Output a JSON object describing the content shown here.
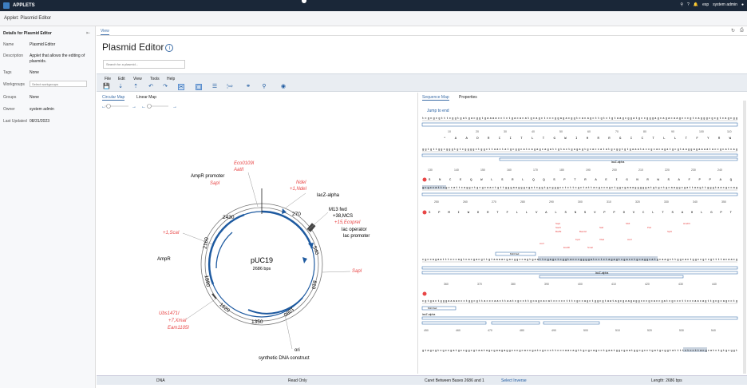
{
  "topbar": {
    "brand": "APPLETS",
    "user": "system admin",
    "notif_label": "esp"
  },
  "breadcrumb": "Applet: Plasmid Editor",
  "details": {
    "header": "Details for Plasmid Editor",
    "fields": [
      {
        "key": "Name",
        "value": "Plasmid Editor"
      },
      {
        "key": "Description",
        "value": "Applet that allows the editing of plasmids."
      },
      {
        "key": "Tags",
        "value": "None"
      },
      {
        "key": "Workgroups",
        "value": ""
      },
      {
        "key": "Groups",
        "value": "None"
      },
      {
        "key": "Owner",
        "value": "system admin"
      },
      {
        "key": "Last Updated",
        "value": "08/31/2023"
      }
    ],
    "workgroup_placeholder": "Select workgroups"
  },
  "tab_view": "View",
  "title": "Plasmid Editor",
  "search_placeholder": "Search for a plasmid...",
  "menu": [
    "File",
    "Edit",
    "View",
    "Tools",
    "Help"
  ],
  "left_tabs": [
    "Circular Map",
    "Linear Map"
  ],
  "right_tabs": [
    "Sequence Map",
    "Properties"
  ],
  "map": {
    "name": "pUC19",
    "length": "2686 bps",
    "ticks": [
      "270",
      "540",
      "810",
      "1080",
      "1350",
      "1620",
      "1890",
      "2160",
      "2430"
    ],
    "labels": {
      "ampr_promoter": "AmpR promoter",
      "ampr": "AmpR",
      "lacz": "lacZ-alpha",
      "m13": "M13 fwd",
      "mcs": "+38,MCS",
      "lacop": "lac operator",
      "lacprom": "lac promoter",
      "ori": "ori",
      "synth": "synthetic DNA construct"
    },
    "enzymes": {
      "eco0109": "Eco0109I",
      "aat2": "AatII",
      "sap_top": "SapI",
      "nde": "NdeI",
      "nde2": "+1,NdeI",
      "ecopr": "+15,EcopreI",
      "sap_right": "SapI",
      "sca": "+1,ScaI",
      "ubs": "Ubs1471I",
      "xma": "+7,XmaI",
      "eam": "Eam1105I"
    }
  },
  "seq": {
    "jump": "Jump to end",
    "row1": "tcgcgcgtttcggtgatgacggtgaaaacctctgacacatgcagctcccggagacggtcacagcttgtctgtaagcggatgccgggagcagacaagcccgtcagggcgcgtcagcgg",
    "row1_ticks": [
      "10",
      "20",
      "30",
      "40",
      "50",
      "60",
      "70",
      "80",
      "90",
      "100",
      "110"
    ],
    "row1_aa": "* A A D R C I T L T G W I H R R G I C T L L T F Y R W",
    "row2": "ggtgttggcgggtgtcggggctggcttaactatgcggcatcagagcagattgtactgagagtgcaccatatgcggtgtgaaataccgcacagatgcgtaaggagaaaataccgcatcag",
    "row2_ticks": [
      "130",
      "140",
      "150",
      "160",
      "170",
      "180",
      "190",
      "200",
      "210",
      "220",
      "230",
      "240"
    ],
    "lacz_label": "lacZ-alpha",
    "row3_aa": "S N C E Q W L S R L Q Q S P T R A E I G N R W S A F P P A Q",
    "row3": "gcgccattcgccattcaggctgcgcaactgttgggaagggcgatcggtgcgggcctcttcgctattacgccagctggcgaaagggggatgtgctgcaaggcgattaagttgggtaacgccag",
    "row3_ticks": [
      "250",
      "260",
      "270",
      "280",
      "290",
      "300",
      "310",
      "320",
      "330",
      "340",
      "350"
    ],
    "row4_aa": "S P M I W D R T F L L V A L S N S V P P D V C L T S A H L G P T",
    "row4": "cgccagaatttcccagtcacgacgttgtaaaacgacggccagtgaattcgagctcggtacccggggatcctctagagtcgacctgcaggcatgcaagcttggcactggccgtcgttttacaacg",
    "row4_ticks": [
      "360",
      "370",
      "380",
      "390",
      "400",
      "410",
      "420",
      "430",
      "440"
    ],
    "m13_label": "M13 fwd",
    "row5": "cgtgactgggaaaaccctggcgttacccaacttaatcgccttgcagcacatccccctttcgccagctggcgtaatagcgaagaggcccgcaccgatcgcccttcccaacagttgcgcagcctg",
    "row5_ticks": [
      "450",
      "460",
      "470",
      "480",
      "490",
      "500",
      "510",
      "520",
      "530",
      "540"
    ],
    "row6": "gtagcgtcgccgatgccggcgtaatagcgaagaggcccgcaccgatcgcccttcccaacagttgcgcagcctgaatggcgaatggcgcctgatgcggtattttctccttacgcatctgtgcggt"
  },
  "status": {
    "left": "DNA",
    "readonly": "Read Only",
    "caret": "Caret Between Bases 2686 and 1",
    "select_inverse": "Select Inverse",
    "length": "Length: 2686 bps"
  },
  "colors": {
    "accent": "#3d6ea8",
    "enzyme": "#e84646",
    "feature": "#1e5aa0"
  }
}
